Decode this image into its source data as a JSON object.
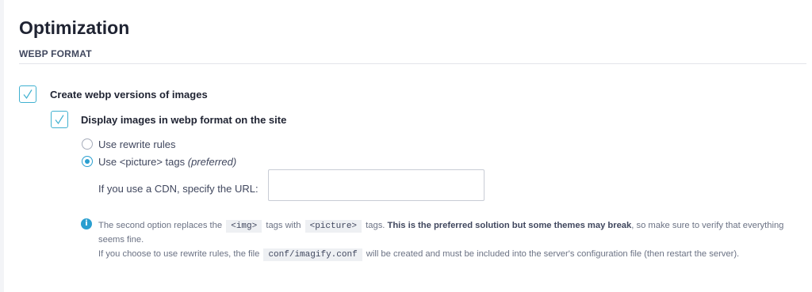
{
  "page": {
    "title": "Optimization",
    "section_label": "WEBP FORMAT"
  },
  "options": {
    "create_webp": {
      "label": "Create webp versions of images",
      "checked": true
    },
    "display_webp": {
      "label": "Display images in webp format on the site",
      "checked": true
    },
    "radios": [
      {
        "label": "Use rewrite rules",
        "checked": false
      },
      {
        "label_main": "Use <picture> tags",
        "label_note": "(preferred)",
        "checked": true
      }
    ],
    "cdn": {
      "label": "If you use a CDN, specify the URL:",
      "value": "",
      "placeholder": ""
    }
  },
  "help": {
    "line1_a": "The second option replaces the",
    "code_img": "<img>",
    "line1_b": "tags with",
    "code_picture": "<picture>",
    "line1_c": "tags.",
    "line1_bold": "This is the preferred solution but some themes may break",
    "line1_d": ", so make sure to verify that everything seems fine.",
    "line2_a": "If you choose to use rewrite rules, the file",
    "code_conf": "conf/imagify.conf",
    "line2_b": "will be created and must be included into the server's configuration file (then restart the server)."
  },
  "icons": {
    "checkmark": "checkmark-icon",
    "info": "info-icon"
  },
  "colors": {
    "accent": "#2a9fd0",
    "checkbox_border": "#40b1d0",
    "background": "#f3f4f7"
  }
}
